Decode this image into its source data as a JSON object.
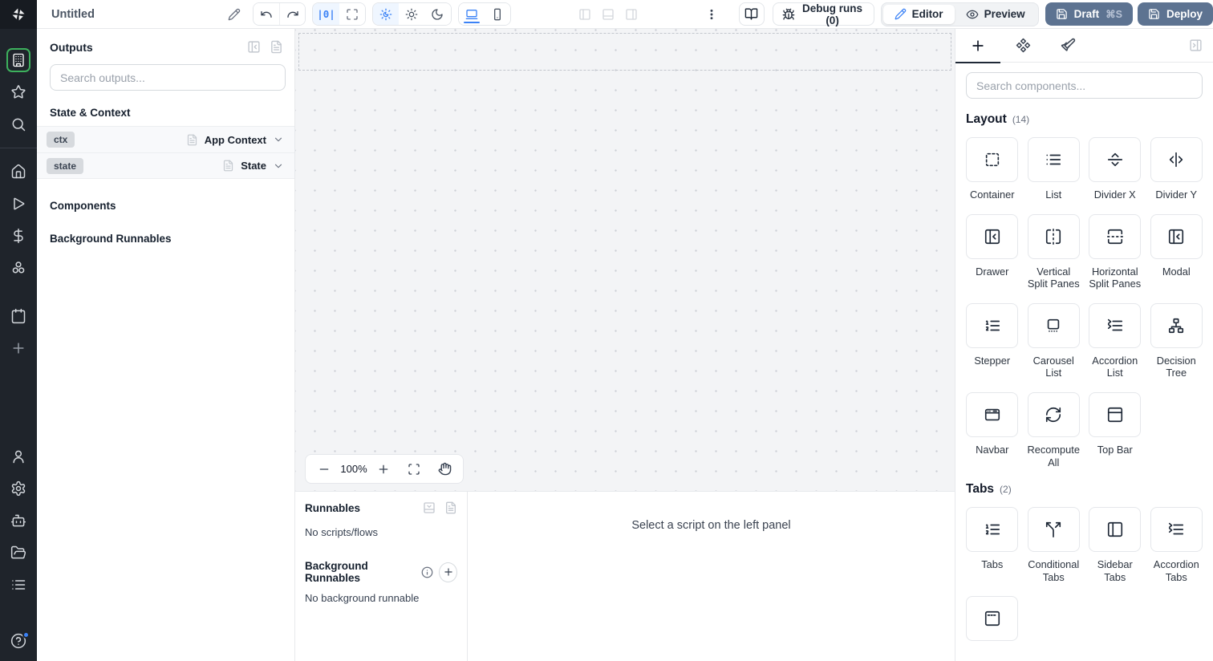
{
  "colors": {
    "accent_blue": "#3b82f6",
    "rail_background": "#1f242b",
    "active_green": "#3db15d",
    "primary_button": "#5d7391"
  },
  "topbar": {
    "title": "Untitled",
    "zoom_code_label": "|0|",
    "debug_runs_label": "Debug runs (0)",
    "editor_label": "Editor",
    "preview_label": "Preview",
    "draft_label": "Draft",
    "draft_shortcut": "⌘S",
    "deploy_label": "Deploy"
  },
  "rail": {
    "logo_icon": "windmill-logo",
    "primary_items": [
      "building",
      "star",
      "search"
    ],
    "secondary_items": [
      "home",
      "play",
      "dollar-sign",
      "hub",
      "calendar",
      "plus"
    ],
    "bottom_items": [
      "user",
      "settings",
      "bot",
      "folder-open",
      "list-rows",
      "help-circle"
    ],
    "active_item": "building"
  },
  "outputs_panel": {
    "title": "Outputs",
    "search_placeholder": "Search outputs...",
    "state_context_heading": "State & Context",
    "components_heading": "Components",
    "background_runnables_heading": "Background Runnables",
    "rows": [
      {
        "badge": "ctx",
        "type": "App Context"
      },
      {
        "badge": "state",
        "type": "State"
      }
    ]
  },
  "canvas": {
    "zoom_level": "100%"
  },
  "runnables_panel": {
    "title": "Runnables",
    "no_scripts": "No scripts/flows",
    "background_title": "Background Runnables",
    "no_background": "No background runnable"
  },
  "script_hint": "Select a script on the left panel",
  "components_panel": {
    "search_placeholder": "Search components...",
    "sections": [
      {
        "title": "Layout",
        "count": "(14)",
        "items": [
          {
            "icon": "container",
            "label": "Container"
          },
          {
            "icon": "list-rows",
            "label": "List"
          },
          {
            "icon": "divider-x",
            "label": "Divider X"
          },
          {
            "icon": "divider-y",
            "label": "Divider Y"
          },
          {
            "icon": "drawer",
            "label": "Drawer"
          },
          {
            "icon": "vertical-split",
            "label": "Vertical Split Panes"
          },
          {
            "icon": "horizontal-split",
            "label": "Horizontal Split Panes"
          },
          {
            "icon": "modal",
            "label": "Modal"
          },
          {
            "icon": "stepper",
            "label": "Stepper"
          },
          {
            "icon": "carousel",
            "label": "Carousel List"
          },
          {
            "icon": "accordion",
            "label": "Accordion List"
          },
          {
            "icon": "decision-tree",
            "label": "Decision Tree"
          },
          {
            "icon": "navbar",
            "label": "Navbar"
          },
          {
            "icon": "recompute-all",
            "label": "Recompute All"
          },
          {
            "icon": "top-bar",
            "label": "Top Bar"
          }
        ]
      },
      {
        "title": "Tabs",
        "count": "(2)",
        "items": [
          {
            "icon": "tabs",
            "label": "Tabs"
          },
          {
            "icon": "conditional-tabs",
            "label": "Conditional Tabs"
          },
          {
            "icon": "sidebar-tabs",
            "label": "Sidebar Tabs"
          },
          {
            "icon": "accordion-tabs",
            "label": "Accordion Tabs"
          }
        ]
      },
      {
        "title": "",
        "count": "",
        "items": [
          {
            "icon": "invisible-tabs",
            "label": ""
          }
        ]
      }
    ]
  }
}
